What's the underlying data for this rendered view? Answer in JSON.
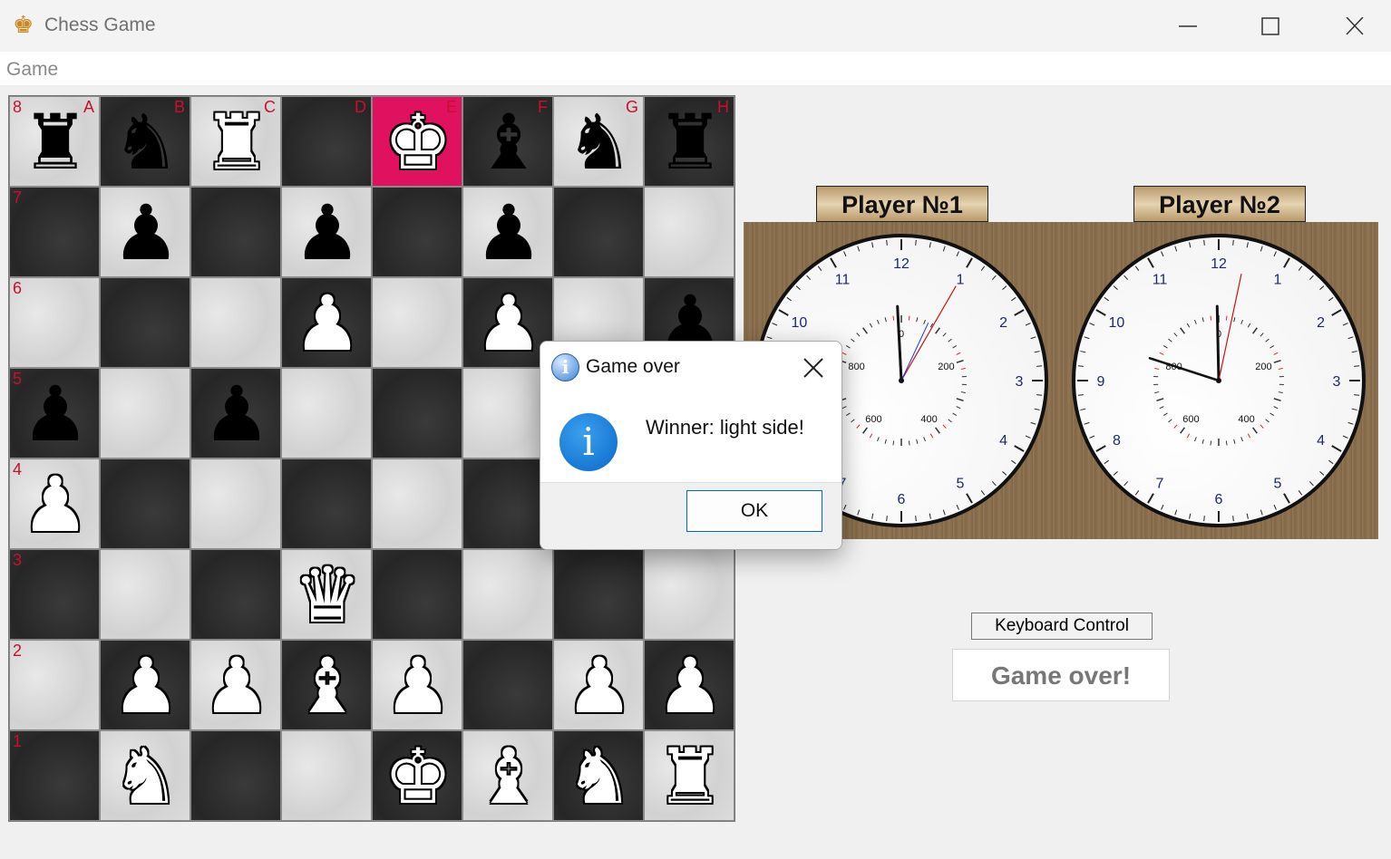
{
  "window": {
    "title": "Chess Game",
    "icon": "crown-icon",
    "controls": [
      "minimize-icon",
      "maximize-icon",
      "close-icon"
    ]
  },
  "menu": {
    "game": "Game"
  },
  "board": {
    "files": [
      "A",
      "B",
      "C",
      "D",
      "E",
      "F",
      "G",
      "H"
    ],
    "ranks": [
      "8",
      "7",
      "6",
      "5",
      "4",
      "3",
      "2",
      "1"
    ],
    "highlight_square": "E8",
    "highlight_color": "#e0115f",
    "squares": [
      [
        "bR",
        "bN",
        "wR",
        "",
        "wK",
        "bB",
        "bN",
        "bR"
      ],
      [
        "",
        "bP",
        "",
        "bP",
        "",
        "bP",
        "",
        ""
      ],
      [
        "",
        "",
        "",
        "wP",
        "",
        "wP",
        "",
        "bP"
      ],
      [
        "bP",
        "",
        "bP",
        "",
        "",
        "",
        "",
        ""
      ],
      [
        "wP",
        "",
        "",
        "",
        "",
        "",
        "",
        ""
      ],
      [
        "",
        "",
        "",
        "wQ",
        "",
        "",
        "",
        ""
      ],
      [
        "",
        "wP",
        "wP",
        "wB",
        "wP",
        "",
        "wP",
        "wP"
      ],
      [
        "",
        "wN",
        "",
        "",
        "wK",
        "wB",
        "wN",
        "wR"
      ]
    ]
  },
  "players": {
    "player1": "Player №1",
    "player2": "Player №2"
  },
  "clock": {
    "hour_numerals": [
      "12",
      "1",
      "2",
      "3",
      "4",
      "5",
      "6",
      "7",
      "8",
      "9",
      "10",
      "11"
    ],
    "sub_dial_labels": [
      "0",
      "200",
      "400",
      "600",
      "800"
    ],
    "player1": {
      "hour": 11.9,
      "minute": 59.5,
      "second": 35
    },
    "player2": {
      "hour": 9.6,
      "minute": 59.8,
      "second": 32
    }
  },
  "controls": {
    "keyboard_control": "Keyboard Control",
    "status": "Game over!"
  },
  "dialog": {
    "title": "Game over",
    "message": "Winner: light side!",
    "ok": "OK",
    "icon": "info-icon"
  }
}
